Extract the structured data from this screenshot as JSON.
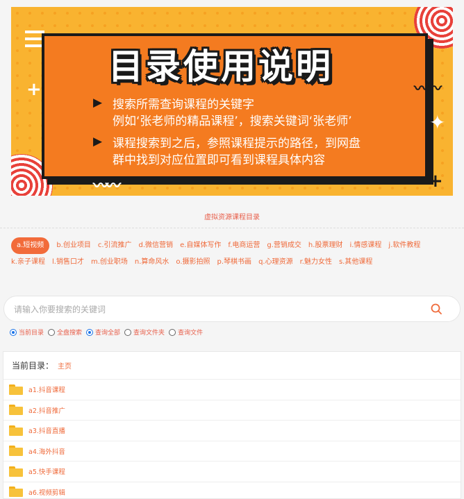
{
  "banner": {
    "title": "目录使用说明",
    "line1": "搜索所需查询课程的关键字",
    "line2": "例如‘张老师的精品课程’，搜索关键词‘张老师’",
    "line3": "课程搜索到之后，参照课程提示的路径，到网盘",
    "line4": "群中找到对应位置即可看到课程具体内容"
  },
  "directory_title": "虚拟资源课程目录",
  "categories": [
    "a.短视频",
    "b.创业项目",
    "c.引流推广",
    "d.微信营销",
    "e.自媒体写作",
    "f.电商运营",
    "g.营销成交",
    "h.股票理财",
    "i.情感课程",
    "j.软件教程",
    "k.亲子课程",
    "l.销售口才",
    "m.创业职场",
    "n.算命风水",
    "o.摄影拍照",
    "p.琴棋书画",
    "q.心理资源",
    "r.魅力女性",
    "s.其他课程"
  ],
  "active_category": "a.短视频",
  "search": {
    "placeholder": "请输入你要搜索的关键词"
  },
  "radios": [
    {
      "label": "当前目录",
      "checked": true
    },
    {
      "label": "全盘搜索",
      "checked": false
    },
    {
      "label": "查询全部",
      "checked": true
    },
    {
      "label": "查询文件夹",
      "checked": false
    },
    {
      "label": "查询文件",
      "checked": false
    }
  ],
  "breadcrumb": {
    "label": "当前目录：",
    "home": "主页"
  },
  "folders": [
    "a1.抖音课程",
    "a2.抖音推广",
    "a3.抖音直播",
    "a4.海外抖音",
    "a5.快手课程",
    "a6.视频剪辑"
  ],
  "colors": {
    "accent": "#ef6a3a",
    "banner_bg": "#f9b330",
    "banner_box": "#f47b20",
    "radio_on": "#1a73e8"
  }
}
